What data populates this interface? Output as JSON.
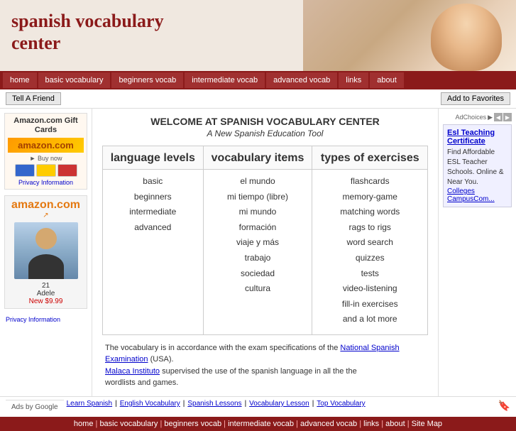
{
  "header": {
    "title_line1": "spanish vocabulary",
    "title_line2": "center"
  },
  "nav": {
    "items": [
      {
        "label": "home",
        "active": false
      },
      {
        "label": "basic vocabulary",
        "active": false
      },
      {
        "label": "beginners vocab",
        "active": false
      },
      {
        "label": "intermediate vocab",
        "active": false
      },
      {
        "label": "advanced vocab",
        "active": false
      },
      {
        "label": "links",
        "active": false
      },
      {
        "label": "about",
        "active": false
      }
    ]
  },
  "action_bar": {
    "tell_a_friend": "Tell A Friend",
    "add_to_favorites": "Add to Favorites"
  },
  "welcome": {
    "title": "WELCOME AT SPANISH VOCABULARY CENTER",
    "subtitle": "A New Spanish Education Tool"
  },
  "columns": [
    {
      "header": "language levels",
      "items": [
        "basic",
        "beginners",
        "intermediate",
        "advanced"
      ]
    },
    {
      "header": "vocabulary items",
      "items": [
        "el mundo",
        "mi tiempo (libre)",
        "mi mundo",
        "formación",
        "viaje y más",
        "trabajo",
        "sociedad",
        "cultura"
      ]
    },
    {
      "header": "types of exercises",
      "items": [
        "flashcards",
        "memory-game",
        "matching words",
        "rags to rigs",
        "word search",
        "quizzes",
        "tests",
        "video-listening",
        "fill-in exercises",
        "and a lot more"
      ]
    }
  ],
  "bottom_text": {
    "line1": "The vocabulary is in accordance with the exam specifications of the",
    "link_text": "National Spanish Examination",
    "line2": " (USA).",
    "line3": "supervised the use of the spanish language in all the the",
    "line4": "wordlists and games.",
    "malaca_text": "Malaca Instituto"
  },
  "left_sidebar": {
    "amazon_title": "Amazon.com Gift Cards",
    "amazon_tagline": "Buy now",
    "amazon_logo": "amazon.com",
    "privacy": "Privacy Information",
    "celeb_number": "21",
    "celeb_name": "Adele",
    "celeb_price": "New $9.99",
    "privacy2": "Privacy Information"
  },
  "right_sidebar": {
    "adchoices": "AdChoices",
    "ad_title": "Esl Teaching Certificate",
    "ad_text": "Find Affordable ESL Teacher Schools. Online & Near You.",
    "ad_link": "Colleges CampusCom..."
  },
  "bottom_links": [
    "Learn Spanish",
    "English Vocabulary",
    "Spanish Lessons",
    "Vocabulary Lesson",
    "Top Vocabulary"
  ],
  "footer_links": [
    "home",
    "basic vocabulary",
    "beginners vocab",
    "intermediate vocab",
    "advanced vocab",
    "links",
    "about",
    "Site Map"
  ],
  "ads_by_google": "Ads by Google"
}
